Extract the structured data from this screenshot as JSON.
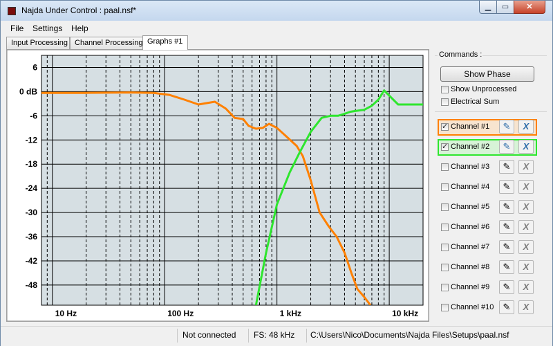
{
  "window": {
    "title": "Najda Under Control : paal.nsf*"
  },
  "menu": [
    "File",
    "Settings",
    "Help"
  ],
  "tabs": [
    {
      "label": "Input Processing",
      "active": false
    },
    {
      "label": "Channel Processing",
      "active": false
    },
    {
      "label": "Graphs #1",
      "active": true
    }
  ],
  "commands": {
    "label": "Commands :",
    "show_phase": "Show Phase",
    "show_unprocessed": {
      "label": "Show Unprocessed",
      "checked": false
    },
    "electrical_sum": {
      "label": "Electrical Sum",
      "checked": false
    }
  },
  "channels": [
    {
      "label": "Channel #1",
      "checked": true,
      "color": "#ff8000"
    },
    {
      "label": "Channel #2",
      "checked": true,
      "color": "#2ee62e"
    },
    {
      "label": "Channel #3",
      "checked": false,
      "color": ""
    },
    {
      "label": "Channel #4",
      "checked": false,
      "color": ""
    },
    {
      "label": "Channel #5",
      "checked": false,
      "color": ""
    },
    {
      "label": "Channel #6",
      "checked": false,
      "color": ""
    },
    {
      "label": "Channel #7",
      "checked": false,
      "color": ""
    },
    {
      "label": "Channel #8",
      "checked": false,
      "color": ""
    },
    {
      "label": "Channel #9",
      "checked": false,
      "color": ""
    },
    {
      "label": "Channel #10",
      "checked": false,
      "color": ""
    }
  ],
  "status": {
    "connection": "Not connected",
    "fs": "FS: 48 kHz",
    "path": "C:\\Users\\Nico\\Documents\\Najda Files\\Setups\\paal.nsf"
  },
  "chart_data": {
    "type": "line",
    "x_scale": "log",
    "xlim": [
      8,
      20000
    ],
    "ylim": [
      -53,
      9
    ],
    "y_ticks": [
      6,
      0,
      -6,
      -12,
      -18,
      -24,
      -30,
      -36,
      -42,
      -48
    ],
    "y_tick_labels": [
      "6",
      "0 dB",
      "-6",
      "-12",
      "-18",
      "-24",
      "-30",
      "-36",
      "-42",
      "-48"
    ],
    "x_ticks": [
      10,
      100,
      1000,
      10000
    ],
    "x_tick_labels": [
      "10 Hz",
      "100 Hz",
      "1 kHz",
      "10 kHz"
    ],
    "background": "#d6dfe3",
    "grid": true,
    "series": [
      {
        "color": "#ff8000",
        "x": [
          8,
          20,
          50,
          80,
          110,
          150,
          200,
          280,
          350,
          420,
          500,
          560,
          650,
          750,
          850,
          1000,
          1200,
          1500,
          1700,
          2000,
          2400,
          2900,
          3400,
          4000,
          4600,
          5200,
          6000,
          6800
        ],
        "y": [
          -0.3,
          -0.3,
          -0.2,
          -0.3,
          -0.8,
          -2.0,
          -3.2,
          -2.5,
          -4.2,
          -6.5,
          -6.8,
          -8.5,
          -9.2,
          -9.0,
          -8.0,
          -9.0,
          -11.0,
          -13.5,
          -16.0,
          -22.0,
          -30.0,
          -33.5,
          -36.0,
          -40.0,
          -45.0,
          -49.0,
          -51.0,
          -53.0
        ]
      },
      {
        "color": "#2ee62e",
        "x": [
          650,
          800,
          1000,
          1300,
          1600,
          2000,
          2500,
          3000,
          3500,
          4000,
          4500,
          5000,
          6000,
          7000,
          8000,
          9000,
          10000,
          12000,
          15000,
          20000
        ],
        "y": [
          -53,
          -40,
          -28,
          -20,
          -15,
          -10,
          -6.5,
          -6,
          -6,
          -5.5,
          -5,
          -4.8,
          -4.5,
          -3.5,
          -2.0,
          0.3,
          -1.0,
          -3.2,
          -3.2,
          -3.2
        ]
      }
    ]
  }
}
